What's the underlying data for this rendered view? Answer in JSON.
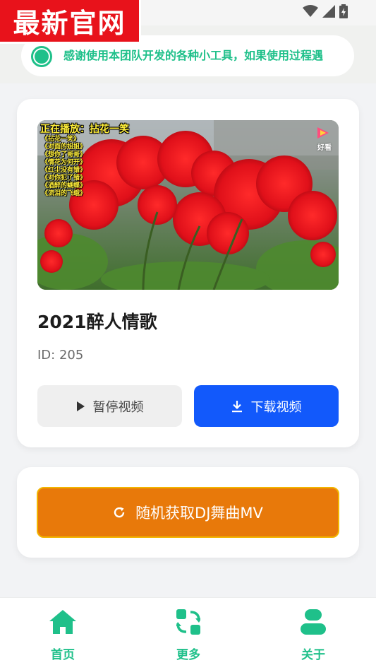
{
  "watermark": {
    "text": "最新官网"
  },
  "notice": {
    "text": "感谢使用本团队开发的各种小工具，如果使用过程遇",
    "accent": "#1fc08a"
  },
  "video": {
    "overlay_title": "正在播放：拈花一笑",
    "overlay_list": [
      "《拈花一笑》",
      "《对面的姐姐》",
      "《想你了哥哥》",
      "《情花为何开》",
      "《红尘没有错》",
      "《对你犯了错》",
      "《酒醉的蝴蝶》",
      "《流泪的飞蛾》"
    ],
    "logo_text": "好看",
    "title": "2021醉人情歌",
    "id_label": "ID: 205"
  },
  "buttons": {
    "pause": {
      "label": "暂停视频",
      "icon": "play-icon"
    },
    "download": {
      "label": "下载视频",
      "icon": "download-icon",
      "color": "#1259fb"
    },
    "random": {
      "label": "随机获取DJ舞曲MV",
      "icon": "refresh-icon",
      "color": "#e8790a"
    }
  },
  "nav": {
    "items": [
      {
        "label": "首页",
        "icon": "home-icon"
      },
      {
        "label": "更多",
        "icon": "switch-icon"
      },
      {
        "label": "关于",
        "icon": "user-icon"
      }
    ]
  }
}
